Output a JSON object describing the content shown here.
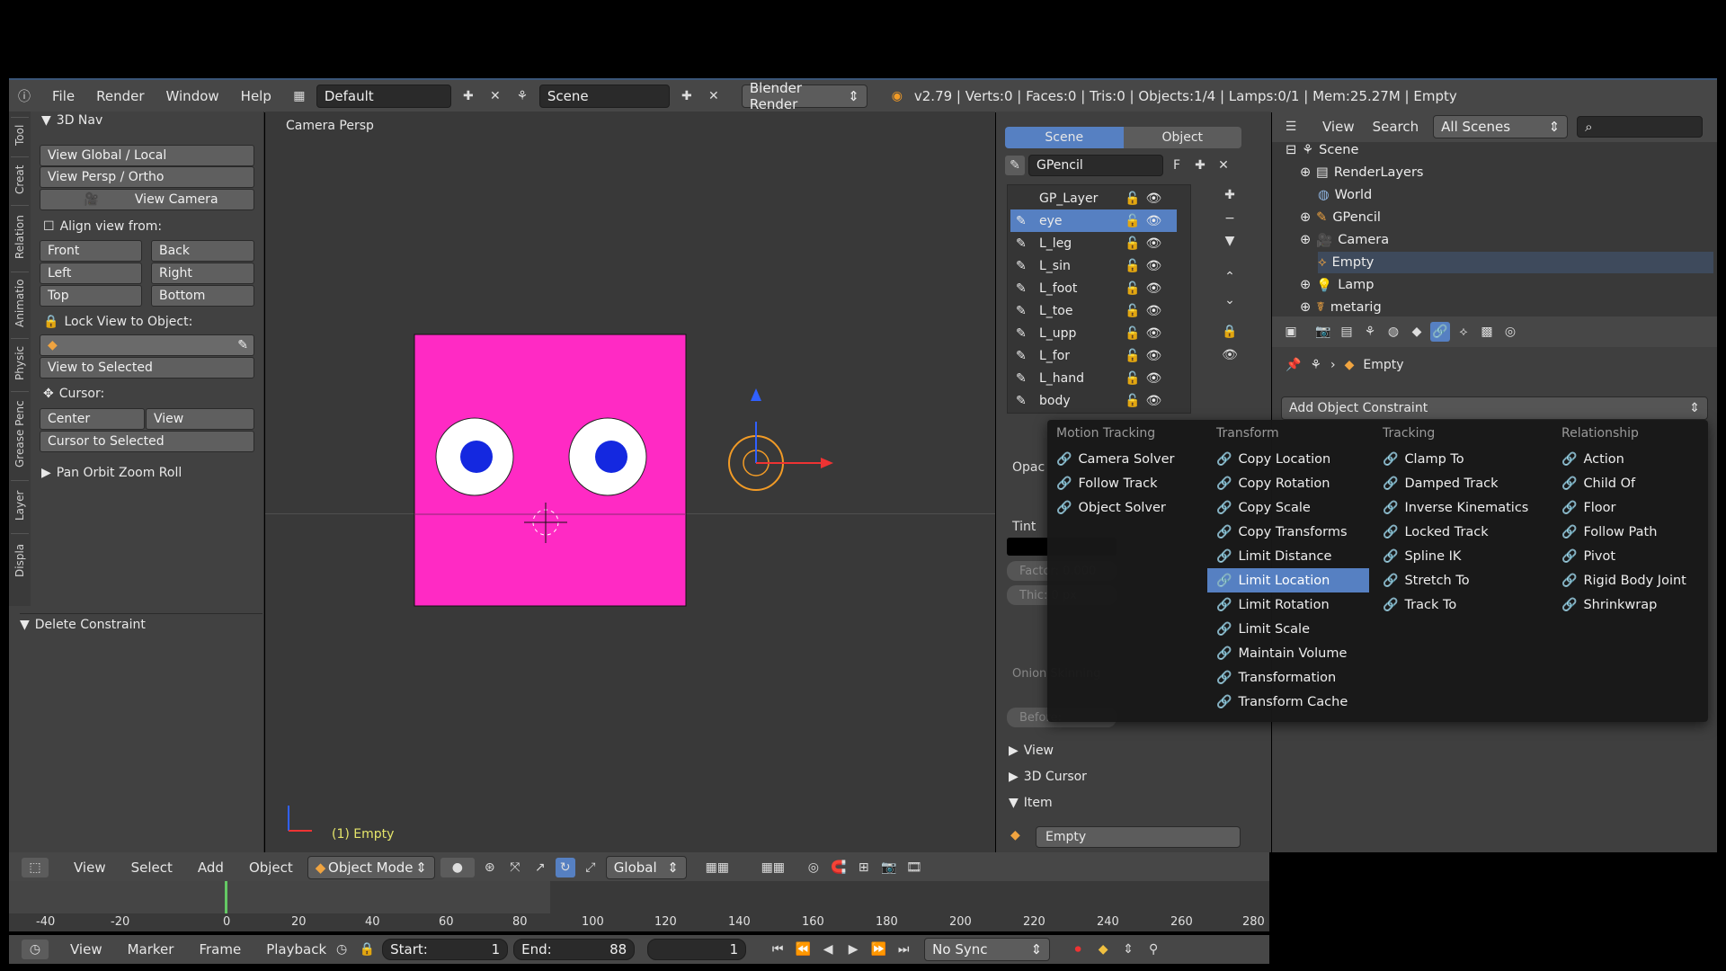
{
  "topbar": {
    "menus": [
      "File",
      "Render",
      "Window",
      "Help"
    ],
    "screen_layout": "Default",
    "scene": "Scene",
    "engine": "Blender Render",
    "stats": "v2.79 | Verts:0 | Faces:0 | Tris:0 | Objects:1/4 | Lamps:0/1 | Mem:25.27M | Empty"
  },
  "vtabs": [
    "Tool",
    "Creat",
    "Relation",
    "Animatio",
    "Physic",
    "Grease Penc",
    "Layer",
    "Displa"
  ],
  "toolshelf": {
    "panel_3dnav": "3D Nav",
    "view_global_local": "View Global / Local",
    "view_persp_ortho": "View Persp / Ortho",
    "view_camera": "View Camera",
    "align_view_from": "Align view from:",
    "front": "Front",
    "back": "Back",
    "left": "Left",
    "right": "Right",
    "top": "Top",
    "bottom": "Bottom",
    "lock_view": "Lock View to Object:",
    "view_selected": "View to Selected",
    "cursor": "Cursor:",
    "center": "Center",
    "view": "View",
    "cursor_selected": "Cursor to Selected",
    "pan_orbit": "Pan Orbit Zoom Roll",
    "delete_constraint": "Delete Constraint"
  },
  "viewport": {
    "label": "Camera Persp",
    "object_info": "(1) Empty",
    "face_color": "#ff2ac4",
    "pupil_color": "#1428e0"
  },
  "gpencil": {
    "tabs": [
      "Scene",
      "Object"
    ],
    "active_tab": "Scene",
    "datablock": "GPencil",
    "fake_user": "F",
    "layers": [
      "GP_Layer",
      "eye",
      "L_leg",
      "L_sin",
      "L_foot",
      "L_toe",
      "L_upp",
      "L_for",
      "L_hand",
      "body"
    ],
    "selected_layer": "eye",
    "opacity_label": "Opac",
    "tint": "Tint",
    "factor": "Factor: 0.000",
    "thickness": "Thic: 0 px",
    "onion": "Onion Skinning",
    "before": "Before:",
    "panels": [
      "View",
      "3D Cursor",
      "Item"
    ],
    "item_name": "Empty"
  },
  "outliner": {
    "menus": [
      "View",
      "Search"
    ],
    "filter": "All Scenes",
    "tree": [
      "Scene",
      "RenderLayers",
      "World",
      "GPencil",
      "Camera",
      "Empty",
      "Lamp",
      "metarig"
    ]
  },
  "properties": {
    "object_name": "Empty",
    "add_constraint": "Add Object Constraint"
  },
  "constraint_menu": {
    "columns": [
      {
        "title": "Motion Tracking",
        "items": [
          "Camera Solver",
          "Follow Track",
          "Object Solver"
        ]
      },
      {
        "title": "Transform",
        "items": [
          "Copy Location",
          "Copy Rotation",
          "Copy Scale",
          "Copy Transforms",
          "Limit Distance",
          "Limit Location",
          "Limit Rotation",
          "Limit Scale",
          "Maintain Volume",
          "Transformation",
          "Transform Cache"
        ]
      },
      {
        "title": "Tracking",
        "items": [
          "Clamp To",
          "Damped Track",
          "Inverse Kinematics",
          "Locked Track",
          "Spline IK",
          "Stretch To",
          "Track To"
        ]
      },
      {
        "title": "Relationship",
        "items": [
          "Action",
          "Child Of",
          "Floor",
          "Follow Path",
          "Pivot",
          "Rigid Body Joint",
          "Shrinkwrap"
        ]
      }
    ],
    "highlighted": "Limit Location"
  },
  "view3d_header": {
    "menus": [
      "View",
      "Select",
      "Add",
      "Object"
    ],
    "mode": "Object Mode",
    "orientation": "Global"
  },
  "timeline": {
    "ticks": [
      "-40",
      "-20",
      "0",
      "20",
      "40",
      "60",
      "80",
      "100",
      "120",
      "140",
      "160",
      "180",
      "200",
      "220",
      "240",
      "260",
      "280"
    ],
    "menus": [
      "View",
      "Marker",
      "Frame",
      "Playback"
    ],
    "start_label": "Start:",
    "start": "1",
    "end_label": "End:",
    "end": "88",
    "current": "1",
    "sync": "No Sync"
  }
}
